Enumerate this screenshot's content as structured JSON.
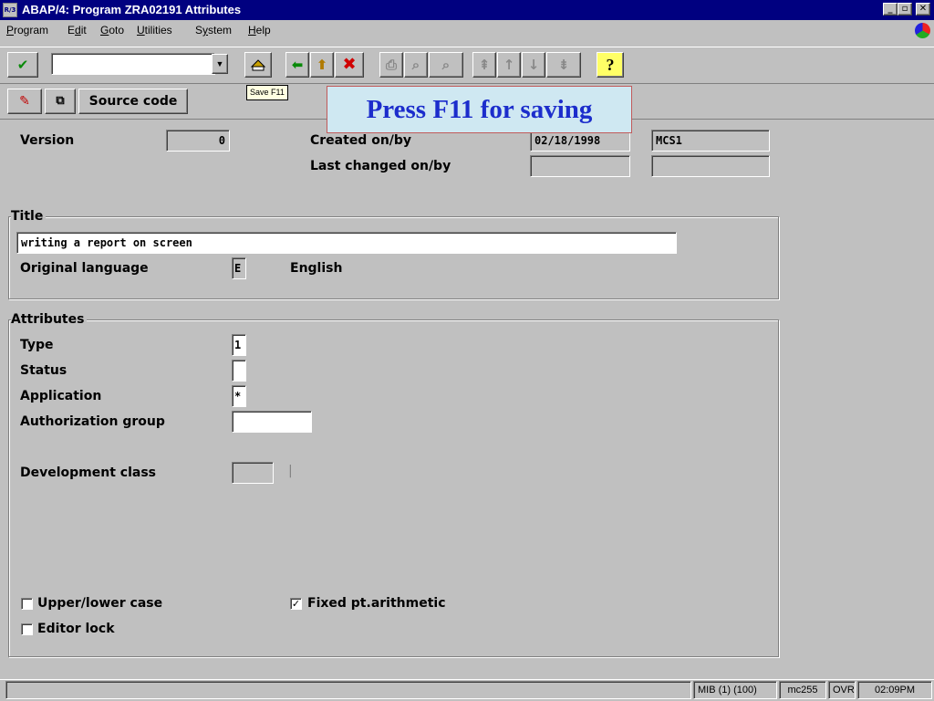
{
  "window": {
    "icon_text": "R/3",
    "title": "ABAP/4: Program ZRA02191 Attributes",
    "controls": {
      "minimize": "_",
      "maximize": "▫",
      "close": "✕"
    }
  },
  "menu": [
    {
      "pre": "",
      "u": "P",
      "post": "rogram"
    },
    {
      "pre": "E",
      "u": "d",
      "post": "it"
    },
    {
      "pre": "",
      "u": "G",
      "post": "oto"
    },
    {
      "pre": "",
      "u": "U",
      "post": "tilities"
    },
    {
      "pre": "S",
      "u": "y",
      "post": "stem"
    },
    {
      "pre": "",
      "u": "H",
      "post": "elp"
    }
  ],
  "toolbar": {
    "command_value": "",
    "tooltip": "Save  F11",
    "icons": [
      "check-icon",
      "save-icon",
      "back-icon",
      "exit-icon",
      "cancel-icon",
      "print-icon",
      "find-icon",
      "find-next-icon",
      "first-page-icon",
      "previous-page-icon",
      "next-page-icon",
      "last-page-icon",
      "help-icon"
    ]
  },
  "app_toolbar": {
    "source_code_label": "Source code"
  },
  "callout": "Press  F11 for saving",
  "header": {
    "version_label": "Version",
    "version_value": "0",
    "created_label": "Created on/by",
    "created_date": "02/18/1998",
    "created_user": "MCS1",
    "changed_label": "Last changed on/by",
    "changed_date": "",
    "changed_user": ""
  },
  "title_group": {
    "title": "Title",
    "value": "writing a report on screen",
    "orig_lang_label": "Original language",
    "orig_lang_value": "E",
    "orig_lang_text": "English"
  },
  "attributes_group": {
    "title": "Attributes",
    "type_label": "Type",
    "type_value": "1",
    "status_label": "Status",
    "status_value": "",
    "application_label": "Application",
    "application_value": "*",
    "auth_group_label": "Authorization group",
    "auth_group_value": "",
    "dev_class_label": "Development class",
    "dev_class_value": "",
    "dev_class_divider": "|",
    "upper_lower_label": "Upper/lower case",
    "upper_lower_checked": false,
    "fixed_pt_label": "Fixed pt.arithmetic",
    "fixed_pt_checked": true,
    "editor_lock_label": "Editor lock",
    "editor_lock_checked": false,
    "check_mark": "✓"
  },
  "statusbar": {
    "message": "",
    "system": "MIB (1) (100)",
    "server": "mc255",
    "mode": "OVR",
    "time": "02:09PM"
  },
  "colors": {
    "titlebar": "#000080",
    "callout_text": "#1c2dcc",
    "callout_bg": "#cfe8f2"
  }
}
